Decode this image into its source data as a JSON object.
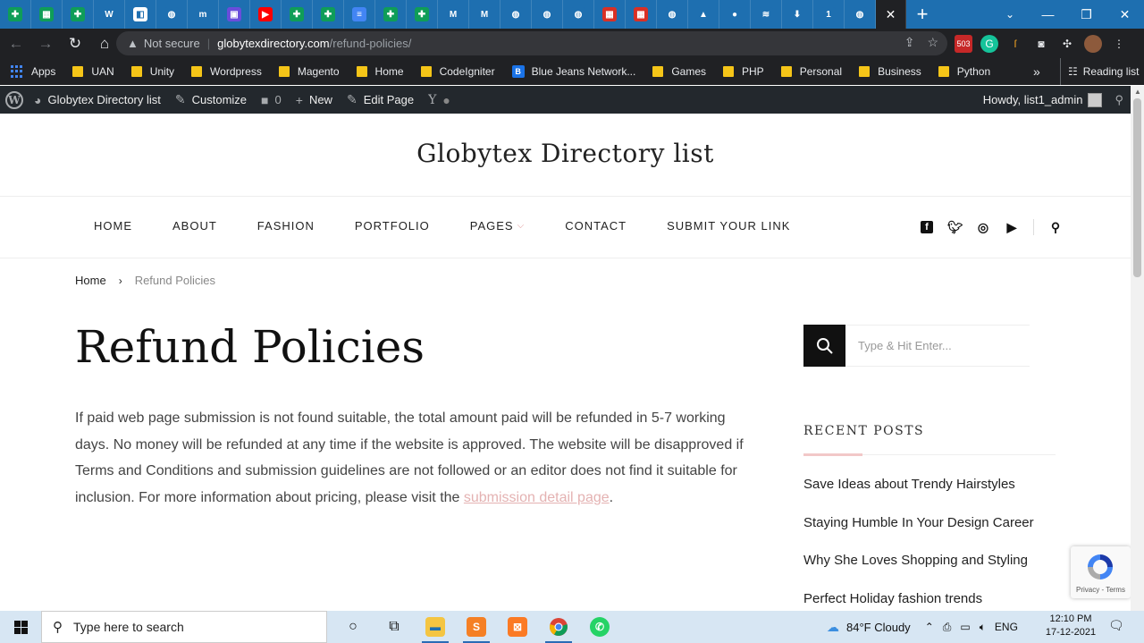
{
  "browser": {
    "tab_favicons": [
      {
        "icon": "sheets-icon",
        "color": "#0f9d58",
        "glyph": "✚"
      },
      {
        "icon": "sheets-icon",
        "color": "#0f9d58",
        "glyph": "▦"
      },
      {
        "icon": "sheets-icon",
        "color": "#0f9d58",
        "glyph": "✚"
      },
      {
        "icon": "wd-icon",
        "color": "#1e6fb0",
        "glyph": "W"
      },
      {
        "icon": "multicolor-icon",
        "color": "#ffffff",
        "glyph": "◧"
      },
      {
        "icon": "globe-icon",
        "color": "#1e6fb0",
        "glyph": "◍"
      },
      {
        "icon": "m-icon",
        "color": "#1e6fb0",
        "glyph": "m"
      },
      {
        "icon": "monitor-icon",
        "color": "#6a4ddb",
        "glyph": "▣"
      },
      {
        "icon": "youtube-icon",
        "color": "#ff0000",
        "glyph": "▶"
      },
      {
        "icon": "sheets-icon",
        "color": "#0f9d58",
        "glyph": "✚"
      },
      {
        "icon": "sheets-icon",
        "color": "#0f9d58",
        "glyph": "✚"
      },
      {
        "icon": "docs-icon",
        "color": "#4285f4",
        "glyph": "≡"
      },
      {
        "icon": "sheets-icon",
        "color": "#0f9d58",
        "glyph": "✚"
      },
      {
        "icon": "sheets-icon",
        "color": "#0f9d58",
        "glyph": "✚"
      },
      {
        "icon": "gmail-icon",
        "color": "#1e6fb0",
        "glyph": "M"
      },
      {
        "icon": "gmail-icon",
        "color": "#1e6fb0",
        "glyph": "M"
      },
      {
        "icon": "globe-icon",
        "color": "#1e6fb0",
        "glyph": "◍"
      },
      {
        "icon": "globe-icon",
        "color": "#1e6fb0",
        "glyph": "◍"
      },
      {
        "icon": "globe-icon",
        "color": "#1e6fb0",
        "glyph": "◍"
      },
      {
        "icon": "grid-icon",
        "color": "#d93025",
        "glyph": "▦"
      },
      {
        "icon": "grid-icon",
        "color": "#d93025",
        "glyph": "▦"
      },
      {
        "icon": "globe-icon",
        "color": "#1e6fb0",
        "glyph": "◍"
      },
      {
        "icon": "triangle-icon",
        "color": "#1e6fb0",
        "glyph": "▲"
      },
      {
        "icon": "github-icon",
        "color": "#1e6fb0",
        "glyph": "●"
      },
      {
        "icon": "stack-icon",
        "color": "#1e6fb0",
        "glyph": "≋"
      },
      {
        "icon": "download-icon",
        "color": "#1e6fb0",
        "glyph": "⬇"
      },
      {
        "icon": "one-icon",
        "color": "#1e6fb0",
        "glyph": "1"
      },
      {
        "icon": "globe-icon",
        "color": "#1e6fb0",
        "glyph": "◍"
      }
    ],
    "active_tab_close": "✕",
    "new_tab": "+",
    "url": {
      "security": "Not secure",
      "domain": "globytexdirectory.com",
      "path": "/refund-policies/"
    },
    "bookmarks": {
      "apps": "Apps",
      "items": [
        "UAN",
        "Unity",
        "Wordpress",
        "Magento",
        "Home",
        "CodeIgniter"
      ],
      "bluejeans": "Blue Jeans Network...",
      "items2": [
        "Games",
        "PHP",
        "Personal",
        "Business",
        "Python"
      ],
      "more": "»",
      "reading_list": "Reading list"
    }
  },
  "admin_bar": {
    "site_name": "Globytex Directory list",
    "customize": "Customize",
    "comments_count": "0",
    "new": "New",
    "edit_page": "Edit Page",
    "howdy": "Howdy, list1_admin"
  },
  "site": {
    "title": "Globytex Directory list",
    "nav": [
      "HOME",
      "ABOUT",
      "FASHION",
      "PORTFOLIO",
      "PAGES",
      "CONTACT",
      "SUBMIT YOUR LINK"
    ],
    "breadcrumb": {
      "home": "Home",
      "current": "Refund Policies"
    },
    "page_title": "Refund Policies",
    "content_text": "If paid web page submission is not found suitable, the total amount paid will be refunded in 5-7 working days. No money will be refunded at any time if the website is approved. The website will be disapproved if Terms and Conditions and submission guidelines are not followed or an editor does not find it suitable for inclusion. For more information about pricing, please visit the ",
    "content_link": "submission detail page",
    "content_end": ".",
    "search_placeholder": "Type & Hit Enter...",
    "recent_posts_title": "RECENT POSTS",
    "recent_posts": [
      "Save Ideas about Trendy Hairstyles",
      "Staying Humble In Your Design Career",
      "Why She Loves Shopping and Styling",
      "Perfect Holiday fashion trends"
    ],
    "recaptcha": "Privacy - Terms",
    "link_color": "#e4b2b2"
  },
  "taskbar": {
    "search_placeholder": "Type here to search",
    "weather": "84°F  Cloudy",
    "language": "ENG",
    "time": "12:10 PM",
    "date": "17-12-2021"
  }
}
